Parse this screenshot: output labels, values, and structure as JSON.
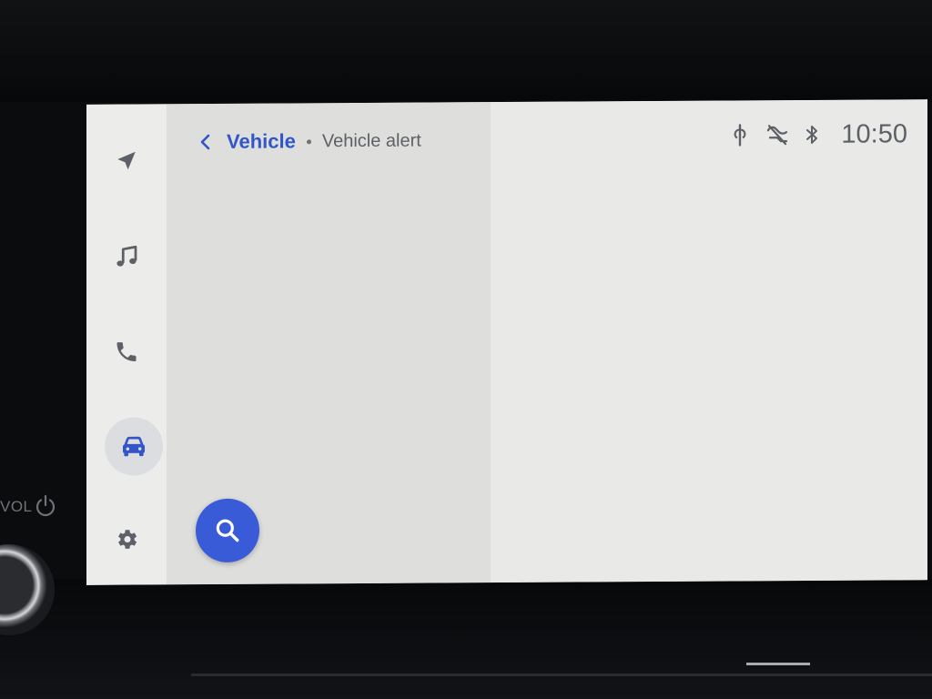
{
  "hardware": {
    "vol_label": "VOL"
  },
  "rail": {
    "items": [
      {
        "name": "navigation",
        "icon": "navigation-arrow-icon"
      },
      {
        "name": "media",
        "icon": "music-note-icon"
      },
      {
        "name": "phone",
        "icon": "phone-icon"
      },
      {
        "name": "vehicle",
        "icon": "car-icon",
        "active": true
      },
      {
        "name": "settings",
        "icon": "gear-icon"
      }
    ]
  },
  "breadcrumb": {
    "current": "Vehicle",
    "child": "Vehicle alert"
  },
  "status": {
    "time": "10:50",
    "icons": [
      "wireless-charging-icon",
      "mic-muted-icon",
      "bluetooth-icon"
    ]
  },
  "colors": {
    "accent": "#3256c9",
    "fab": "#3a5bd8",
    "text_secondary": "#5d6066"
  }
}
